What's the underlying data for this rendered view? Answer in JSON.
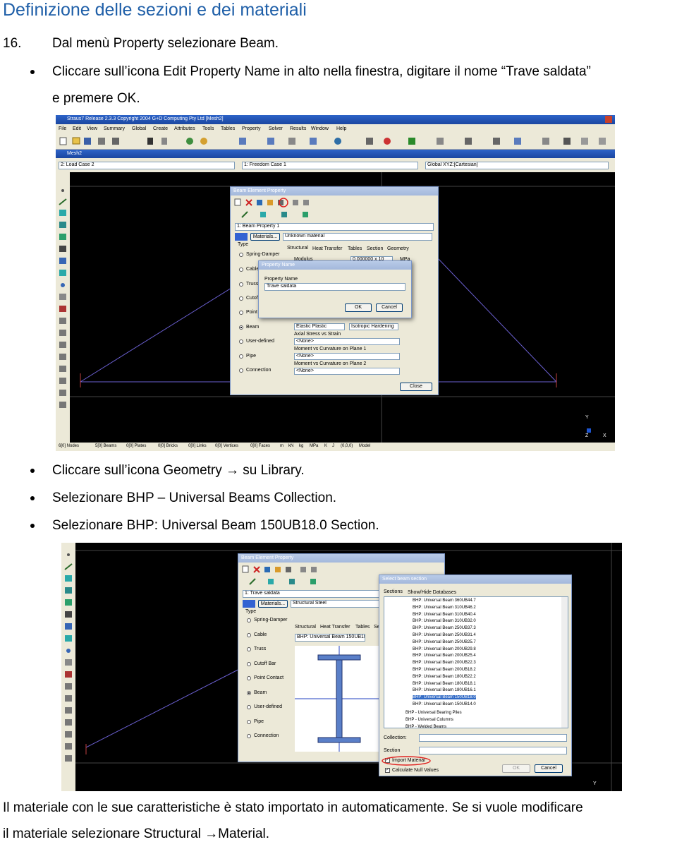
{
  "heading": "Definizione delle sezioni e dei materiali",
  "step": {
    "number": "16.",
    "text": "Dal menù Property selezionare Beam."
  },
  "bullets_top": [
    "Cliccare sull’icona Edit Property Name in alto nella finestra, digitare il nome “Trave saldata”",
    "e premere OK."
  ],
  "bullets_mid": [
    "Cliccare sull’icona Geometry → su Library.",
    "Selezionare BHP – Universal Beams Collection.",
    "Selezionare BHP: Universal Beam 150UB18.0 Section."
  ],
  "footer": [
    "Il materiale con le sue caratteristiche è stato importato in automaticamente. Se si vuole modificare",
    "il materiale selezionare Structural →Material."
  ],
  "shot1": {
    "app_title": "Straus7 Release 2.3.3 Copyright 2004 G+D Computing Pty Ltd [Mesh2]",
    "menu": [
      "File",
      "Edit",
      "View",
      "Summary",
      "Global",
      "Create",
      "Attributes",
      "Tools",
      "Tables",
      "Property",
      "Solver",
      "Results",
      "Window",
      "Help"
    ],
    "doc_title": "Mesh2",
    "load_case": "2: Load Case 2",
    "freedom_case": "1: Freedom Case 1",
    "coord": "Global XYZ:[Cartesian]",
    "status": [
      "6[0] Nodes",
      "5[0] Beams",
      "0[0] Plates",
      "0[0] Bricks",
      "0[0] Links",
      "0[0] Vertices",
      "0[0] Faces",
      "m",
      "kN",
      "kg",
      "MPa",
      "K",
      "J",
      "(0,0,0)",
      "Model"
    ],
    "axis_y": "Y",
    "axis_z": "Z",
    "axis_x": "X",
    "dialog": {
      "title": "Beam Element Property",
      "property_select": "1: Beam Property 1",
      "materials_btn": "Materials...",
      "material_value": "Unknown material",
      "type_label": "Type",
      "types": [
        "Spring-Damper",
        "Cable",
        "Truss",
        "Cutoff",
        "Point",
        "Beam",
        "User-defined",
        "Pipe",
        "Connection"
      ],
      "tabs": [
        "Structural",
        "Heat Transfer",
        "Tables",
        "Section",
        "Geometry"
      ],
      "modulus_label": "Modulus",
      "modulus_value": "0.000000 x 10",
      "modulus_unit": "MPa",
      "elastic": "Elastic Plastic",
      "hardening": "Isotropic Hardening",
      "axial_label": "Axial Stress vs Strain",
      "axial_value": "<None>",
      "mc1_label": "Moment vs Curvature on Plane 1",
      "mc1_value": "<None>",
      "mc2_label": "Moment vs Curvature on Plane 2",
      "mc2_value": "<None>",
      "close": "Close"
    },
    "name_dialog": {
      "title": "Property Name",
      "label": "Property Name",
      "value": "Trave saldata",
      "ok": "OK",
      "cancel": "Cancel"
    }
  },
  "shot2": {
    "dialog_title": "Beam Element Property",
    "property_select": "1: Trave saldata",
    "materials_btn": "Materials...",
    "material_value": "Structural Steel",
    "type_label": "Type",
    "types": [
      "Spring-Damper",
      "Cable",
      "Truss",
      "Cutoff Bar",
      "Point Contact",
      "Beam",
      "User-defined",
      "Pipe",
      "Connection"
    ],
    "tabs": [
      "Structural",
      "Heat Transfer",
      "Tables",
      "Se"
    ],
    "section_value": "BHP: Universal Beam 150UB18.0",
    "select_title": "Select beam section",
    "select_tabs": [
      "Sections",
      "Show/Hide Databases"
    ],
    "sections": [
      "BHP: Universal Beam 360UB44.7",
      "BHP: Universal Beam 310UB46.2",
      "BHP: Universal Beam 310UB40.4",
      "BHP: Universal Beam 310UB32.0",
      "BHP: Universal Beam 250UB37.3",
      "BHP: Universal Beam 250UB31.4",
      "BHP: Universal Beam 250UB25.7",
      "BHP: Universal Beam 200UB29.8",
      "BHP: Universal Beam 200UB25.4",
      "BHP: Universal Beam 200UB22.3",
      "BHP: Universal Beam 200UB18.2",
      "BHP: Universal Beam 180UB22.2",
      "BHP: Universal Beam 180UB18.1",
      "BHP: Universal Beam 180UB16.1",
      "BHP: Universal Beam 150UB18.0",
      "BHP: Universal Beam 150UB14.0"
    ],
    "groups": [
      "BHP - Universal Bearing Piles",
      "BHP - Universal Columns",
      "BHP - Welded Beams"
    ],
    "collection_label": "Collection:",
    "section_label": "Section",
    "import_material": "Import Material",
    "null_values": "Calculate Null Values",
    "ok": "OK",
    "cancel": "Cancel",
    "axis_y": "Y"
  }
}
